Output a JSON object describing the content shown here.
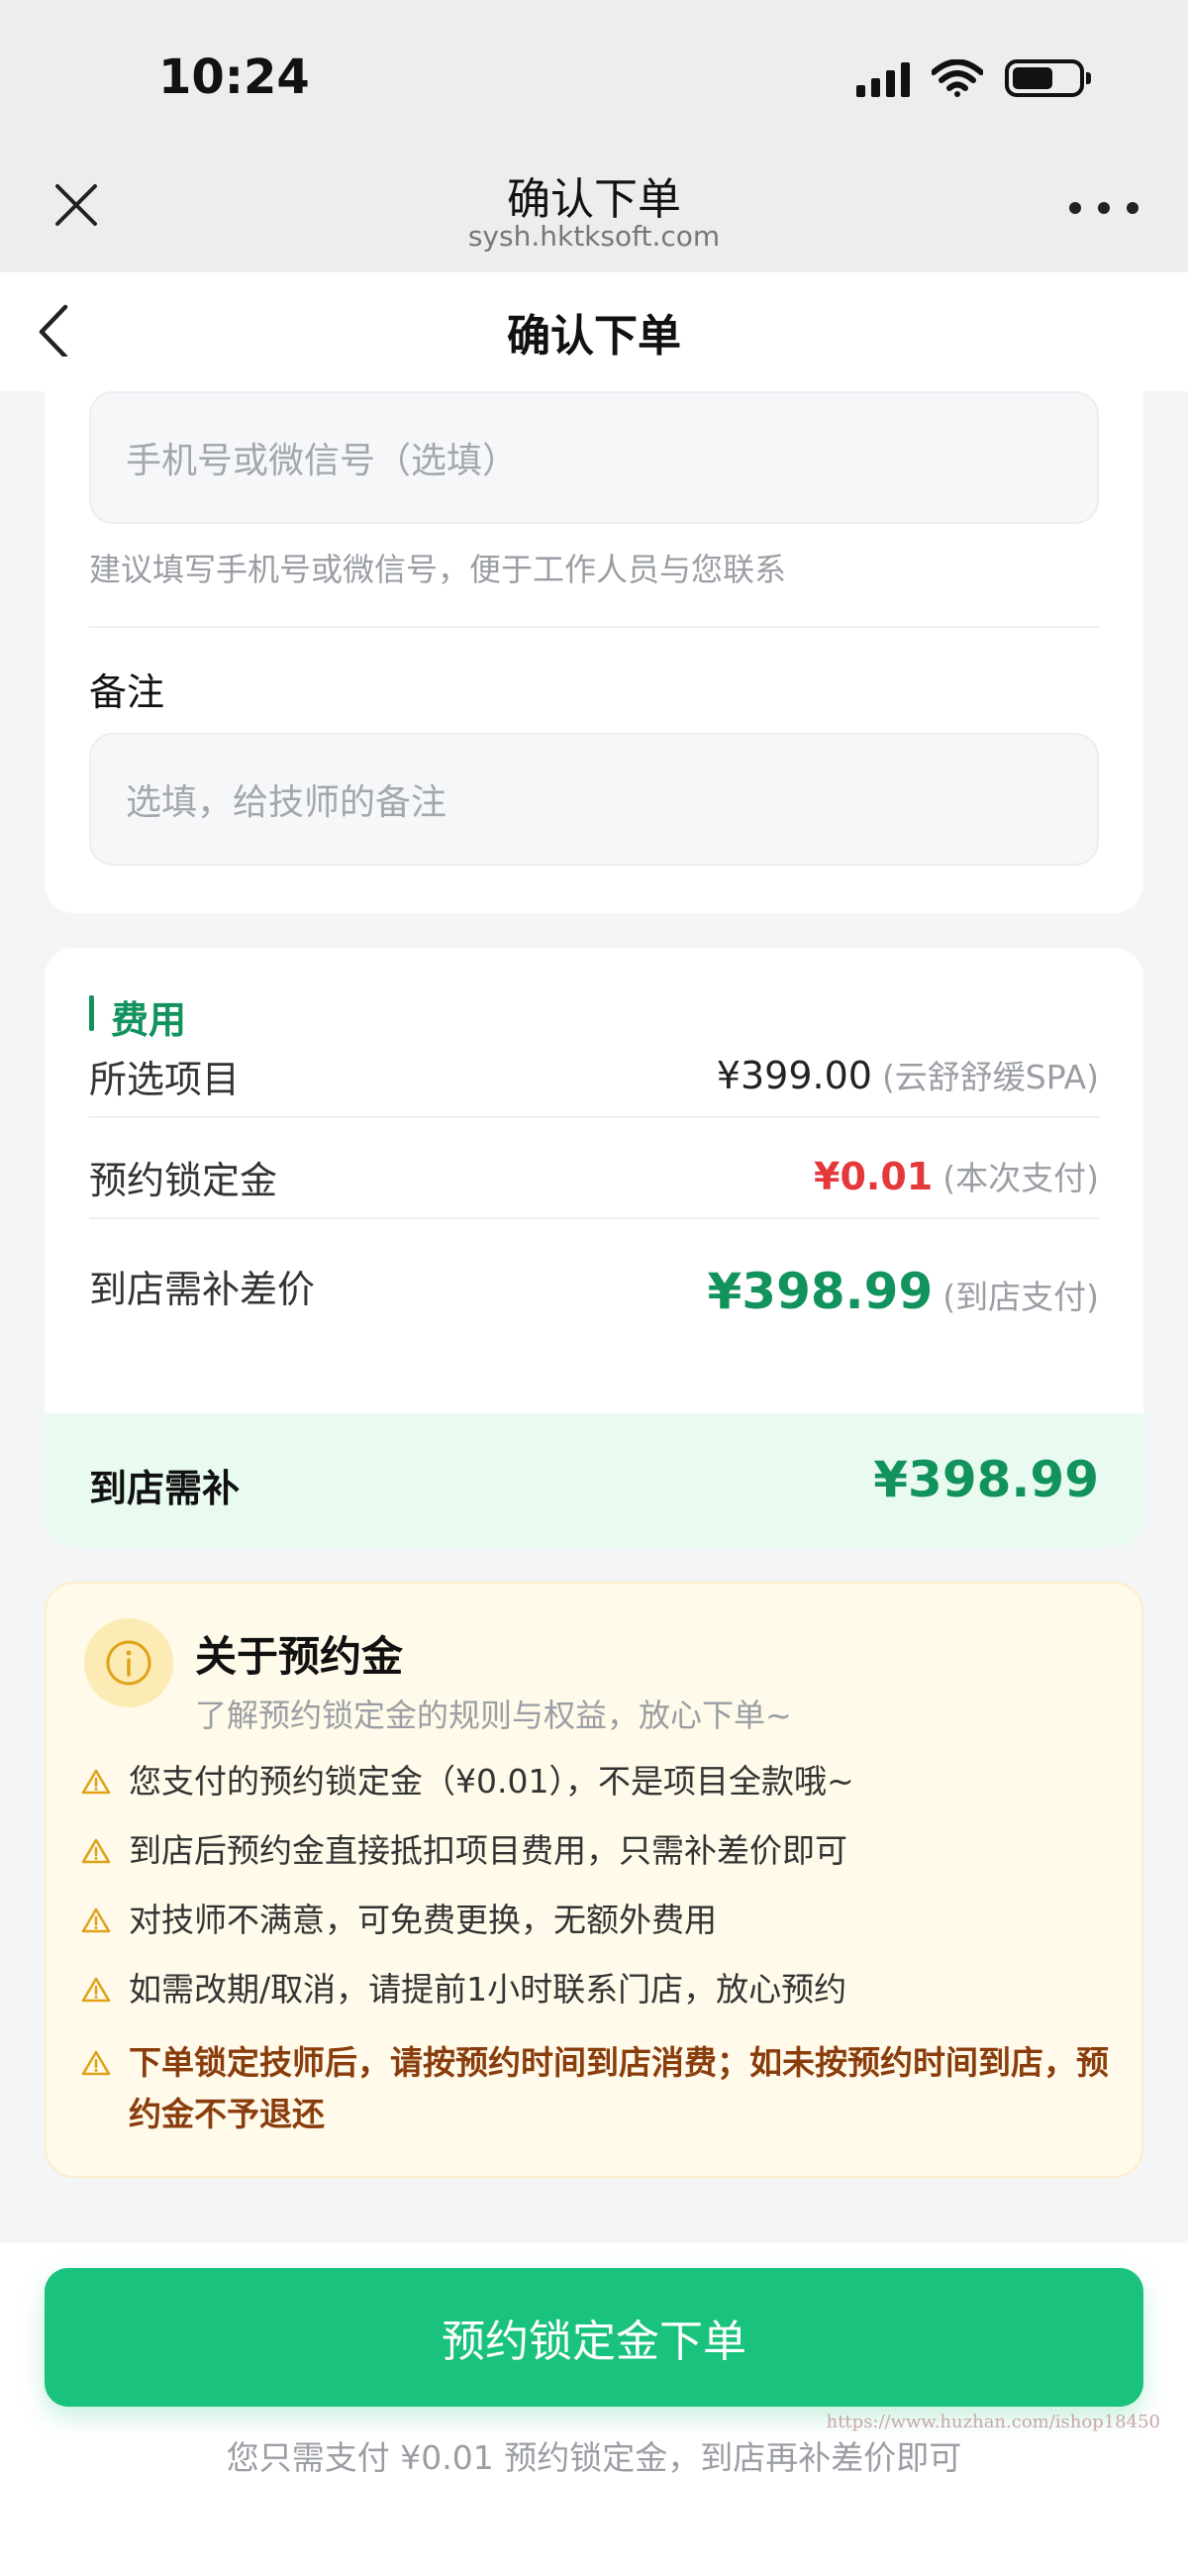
{
  "status_bar": {
    "time": "10:24"
  },
  "browser": {
    "title": "确认下单",
    "url": "sysh.hktksoft.com"
  },
  "nav": {
    "title": "确认下单"
  },
  "contact": {
    "placeholder": "手机号或微信号（选填）",
    "hint": "建议填写手机号或微信号，便于工作人员与您联系"
  },
  "remark": {
    "label": "备注",
    "placeholder": "选填，给技师的备注"
  },
  "fee": {
    "title": "费用",
    "rows": [
      {
        "label": "所选项目",
        "amount": "¥399.00",
        "note": "(云舒舒缓SPA)"
      },
      {
        "label": "预约锁定金",
        "amount": "¥0.01",
        "note": "(本次支付)"
      },
      {
        "label": "到店需补差价",
        "amount": "¥398.99",
        "note": "(到店支付)"
      }
    ],
    "total_label": "到店需补",
    "total_amount": "¥398.99"
  },
  "notice": {
    "title": "关于预约金",
    "subtitle": "了解预约锁定金的规则与权益，放心下单~",
    "items": [
      "您支付的预约锁定金（¥0.01），不是项目全款哦~",
      "到店后预约金直接抵扣项目费用，只需补差价即可",
      "对技师不满意，可免费更换，无额外费用",
      "如需改期/取消，请提前1小时联系门店，放心预约",
      "下单锁定技师后，请按预约时间到店消费；如未按预约时间到店，预约金不予退还"
    ]
  },
  "submit": {
    "label": "预约锁定金下单",
    "tip": "您只需支付 ¥0.01 预约锁定金，到店再补差价即可"
  },
  "watermark": "https://www.huzhan.com/ishop18450",
  "colors": {
    "accent_green": "#12925c",
    "button_green": "#19c27d",
    "price_red": "#e5383b",
    "notice_bg": "#fffaea",
    "warning_text": "#8a3d0c"
  }
}
